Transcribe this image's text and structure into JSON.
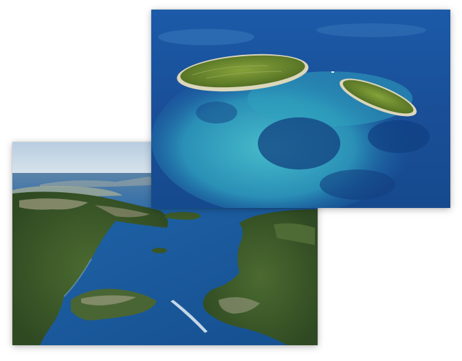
{
  "photos": [
    {
      "id": "back",
      "subject": "aerial-view-of-bay-with-islands",
      "colors": {
        "sky": "#c9d9e6",
        "sea": "#1a5a9c",
        "land": "#3f5a2a",
        "rock": "#a9a48a"
      }
    },
    {
      "id": "front",
      "subject": "aerial-view-of-two-small-islands",
      "colors": {
        "deep_sea": "#0f3e86",
        "shallow": "#3fb3c0",
        "island": "#6d8a2a",
        "beach": "#e7e2c9"
      }
    }
  ]
}
